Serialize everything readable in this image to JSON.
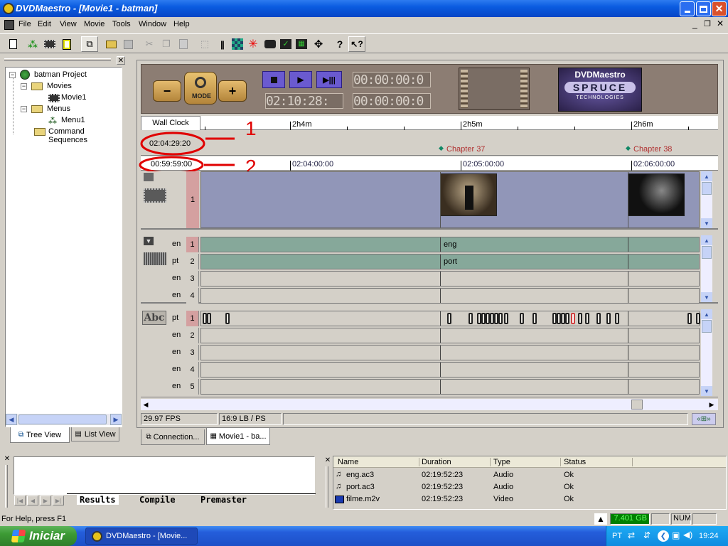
{
  "window": {
    "title": "DVDMaestro - [Movie1 - batman]"
  },
  "menu": {
    "items": [
      "File",
      "Edit",
      "View",
      "Movie",
      "Tools",
      "Window",
      "Help"
    ]
  },
  "toolbar": {
    "icons": [
      "new-file-icon",
      "project-tree-icon",
      "film-icon",
      "script-icon",
      "connection-icon",
      "open-folder-icon",
      "save-icon",
      "cut-icon",
      "copy-icon",
      "paste-icon",
      "import-icon",
      "barcode-icon",
      "grid-icon",
      "red-star-icon",
      "video-asset-icon",
      "green-check-icon",
      "chart-icon",
      "move-icon",
      "help-icon",
      "context-help-icon"
    ]
  },
  "tree": {
    "project": "batman Project",
    "movies": "Movies",
    "movie1": "Movie1",
    "menus": "Menus",
    "menu1": "Menu1",
    "commands": "Command Sequences"
  },
  "left_tabs": {
    "tree": "Tree View",
    "list": "List View"
  },
  "transport": {
    "mode": "MODE",
    "timecodes": [
      "00:00:00:0",
      "02:10:28:",
      "00:00:00:0",
      "00:00:00:0"
    ],
    "logo_top": "DVDMaestro",
    "logo_mid": "SPRUCE",
    "logo_bot": "TECHNOLOGIES"
  },
  "timeline": {
    "wall_clock_label": "Wall Clock",
    "ruler_top": [
      "2h4m",
      "2h5m",
      "2h6m"
    ],
    "ruler_bottom": [
      "02:04:00:00",
      "02:05:00:00",
      "02:06:00:00"
    ],
    "wall_time": "02:04:29:20",
    "movie_time": "00:59:59:00",
    "chapters": [
      "Chapter 37",
      "Chapter 38"
    ],
    "annotations": [
      "1",
      "2"
    ]
  },
  "video_track": {
    "number": "1"
  },
  "audio_tracks": [
    {
      "lang": "en",
      "num": "1",
      "clip": "eng"
    },
    {
      "lang": "pt",
      "num": "2",
      "clip": "port"
    },
    {
      "lang": "en",
      "num": "3",
      "clip": ""
    },
    {
      "lang": "en",
      "num": "4",
      "clip": ""
    }
  ],
  "subtitle_tracks": [
    {
      "lang": "pt",
      "num": "1"
    },
    {
      "lang": "en",
      "num": "2"
    },
    {
      "lang": "en",
      "num": "3"
    },
    {
      "lang": "en",
      "num": "4"
    },
    {
      "lang": "en",
      "num": "5"
    }
  ],
  "subtitle_icon_label": "Abc",
  "status_strip": {
    "fps": "29.97 FPS",
    "aspect": "16:9 LB / PS"
  },
  "doc_tabs": {
    "connection": "Connection...",
    "movie": "Movie1 - ba..."
  },
  "output_tabs": [
    "Results",
    "Compile",
    "Premaster"
  ],
  "assets": {
    "headers": [
      "Name",
      "Duration",
      "Type",
      "Status"
    ],
    "rows": [
      {
        "name": "eng.ac3",
        "duration": "02:19:52:23",
        "type": "Audio",
        "status": "Ok"
      },
      {
        "name": "port.ac3",
        "duration": "02:19:52:23",
        "type": "Audio",
        "status": "Ok"
      },
      {
        "name": "filme.m2v",
        "duration": "02:19:52:23",
        "type": "Video",
        "status": "Ok"
      }
    ]
  },
  "statusbar": {
    "help": "For Help, press F1",
    "disk": "7.401 GB",
    "num": "NUM"
  },
  "taskbar": {
    "start": "Iniciar",
    "task": "DVDMaestro - [Movie...",
    "lang": "PT",
    "time": "19:24"
  },
  "colors": {
    "titlebar": "#0a5be0",
    "taskbar": "#245edb",
    "start": "#3c9a34",
    "video_lane": "#9196b8",
    "audio_lane": "#86a89a",
    "annotation": "#e00000"
  }
}
